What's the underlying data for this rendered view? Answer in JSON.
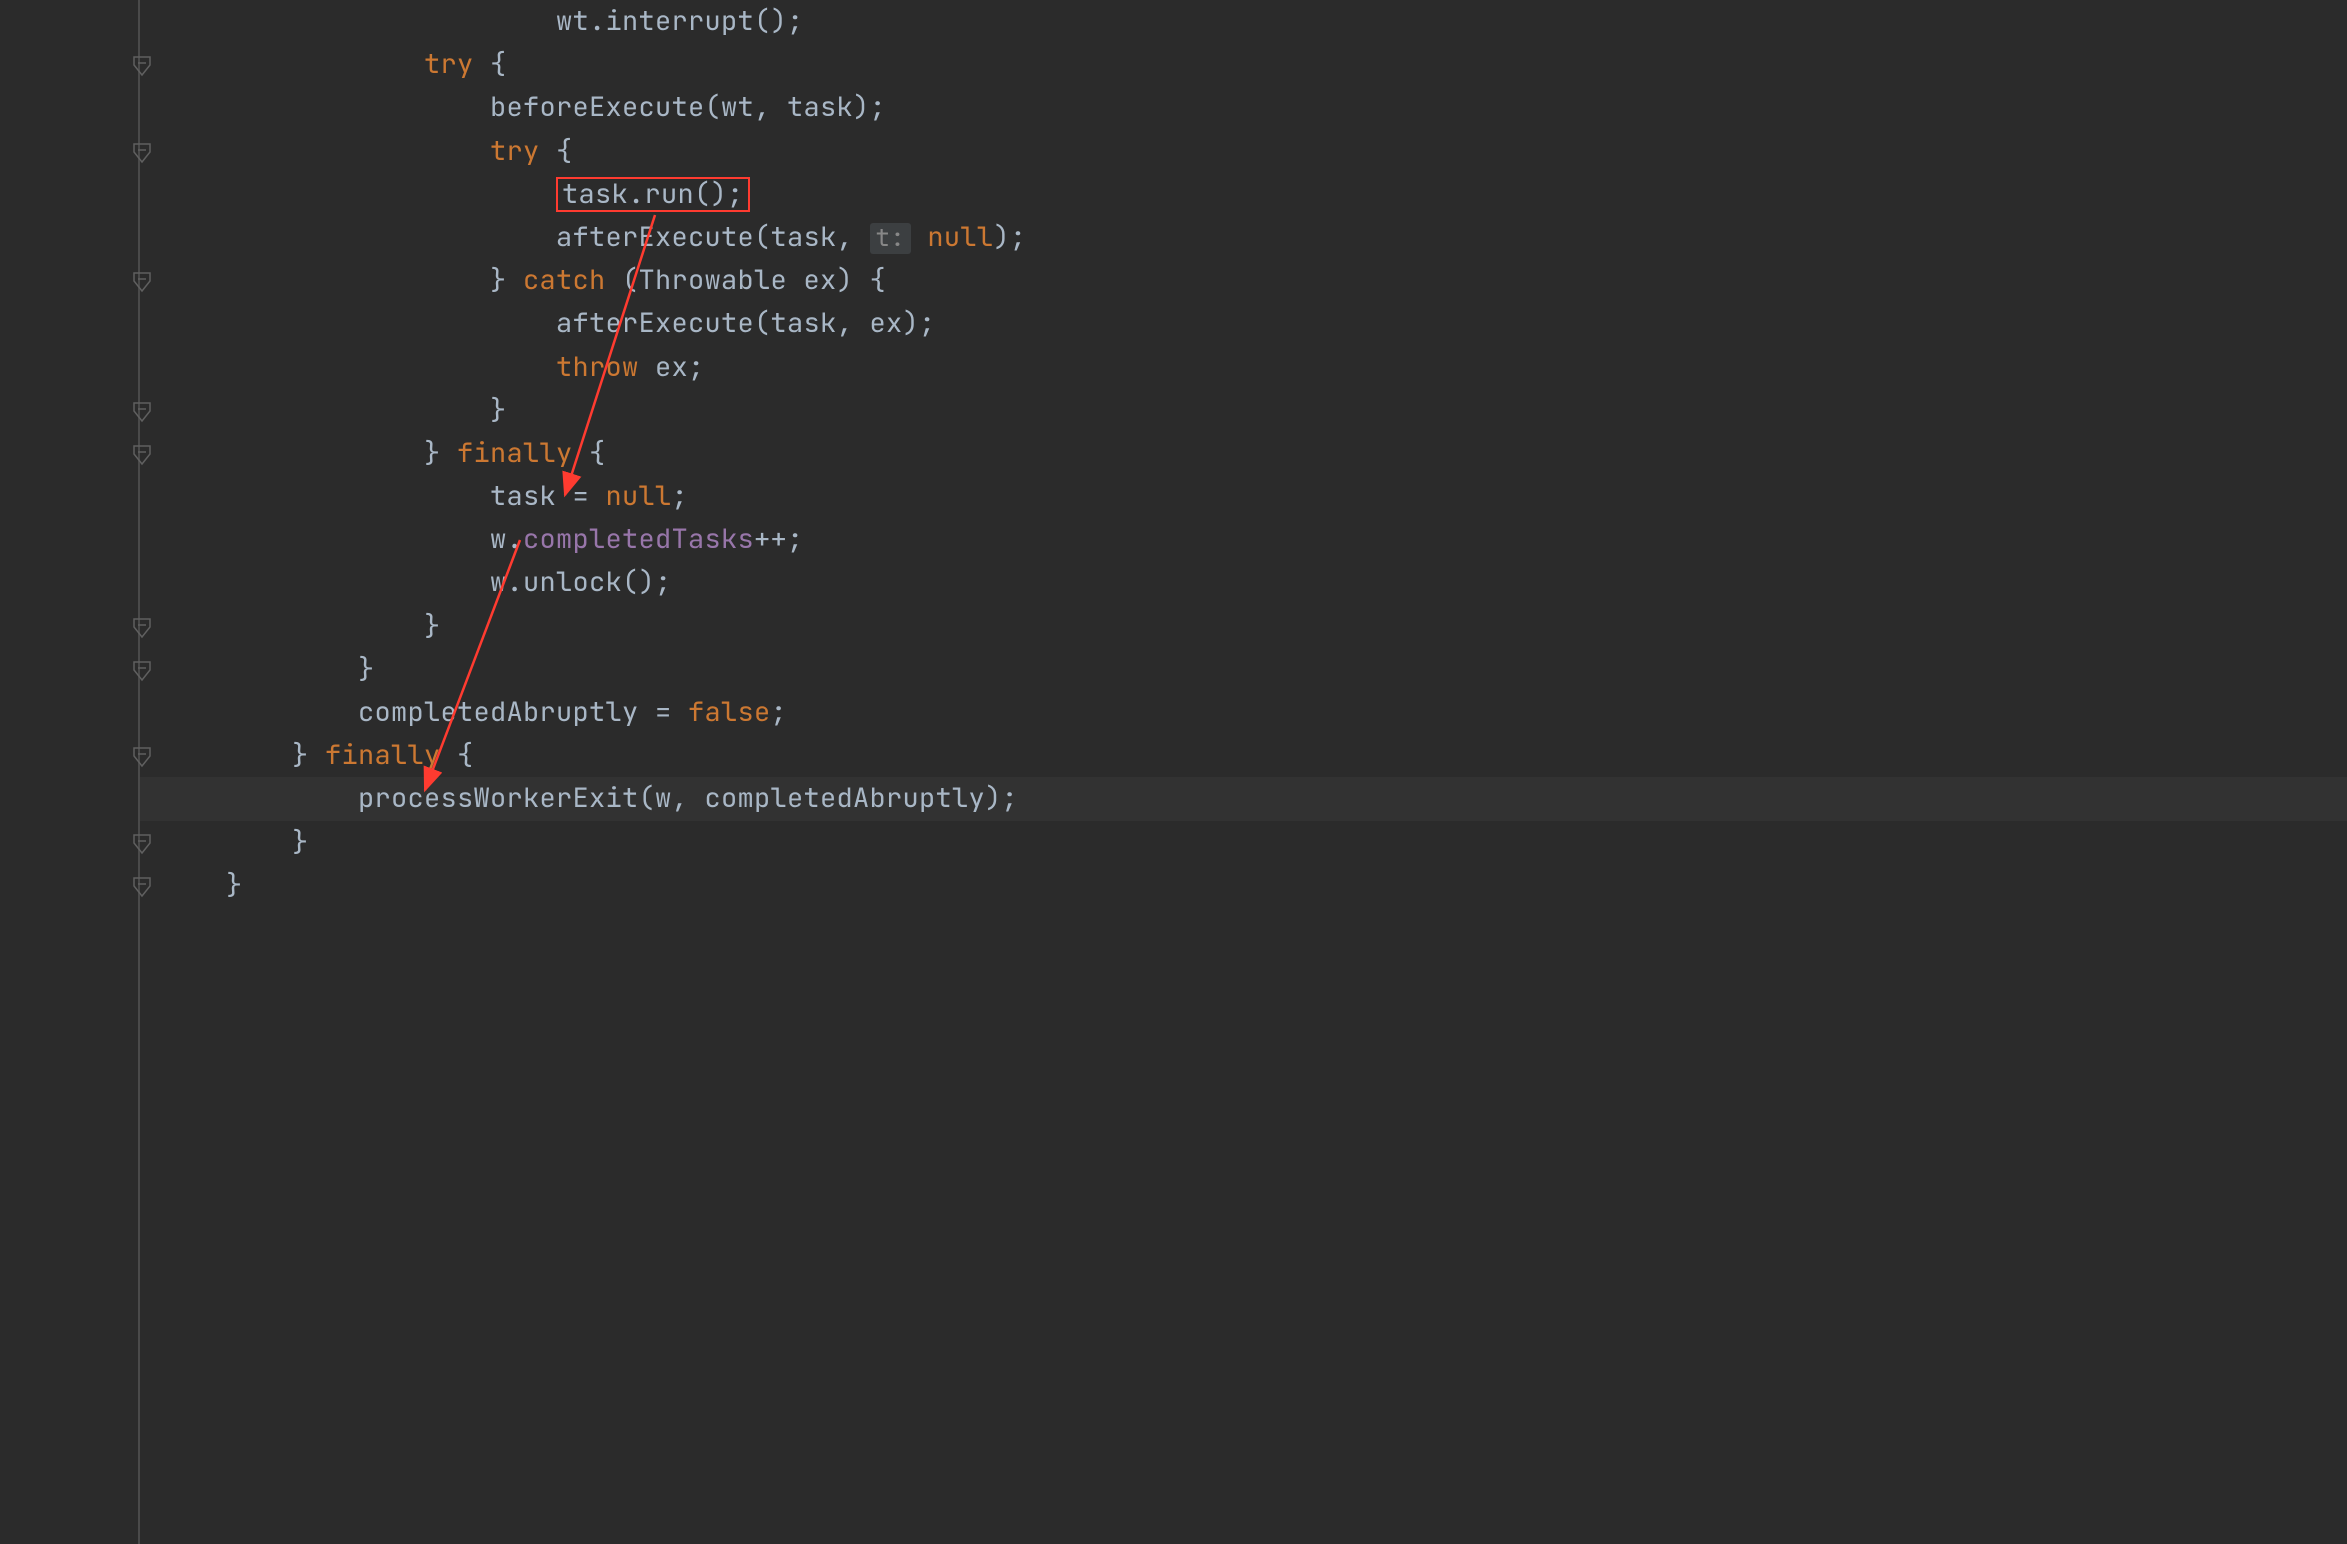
{
  "colors": {
    "background": "#2b2b2b",
    "foreground": "#a9b7c6",
    "keyword": "#cc7832",
    "member": "#9876aa",
    "highlight_box": "#ff3b30",
    "arrow": "#ff3b30",
    "current_line": "#323232",
    "gutter_line": "#4a4a4a",
    "param_hint_bg": "#3c3f41"
  },
  "code": {
    "lines": [
      {
        "indent": 24,
        "tokens": [
          {
            "t": "wt.interrupt();",
            "c": "plain"
          }
        ]
      },
      {
        "indent": 16,
        "tokens": [
          {
            "t": "try",
            "c": "kw"
          },
          {
            "t": " {",
            "c": "plain"
          }
        ],
        "fold": true
      },
      {
        "indent": 20,
        "tokens": [
          {
            "t": "beforeExecute(wt, task);",
            "c": "plain"
          }
        ]
      },
      {
        "indent": 20,
        "tokens": [
          {
            "t": "try",
            "c": "kw"
          },
          {
            "t": " {",
            "c": "plain"
          }
        ],
        "fold": true
      },
      {
        "indent": 24,
        "tokens": [
          {
            "t": "task.run();",
            "c": "plain",
            "boxed": true
          }
        ]
      },
      {
        "indent": 24,
        "tokens": [
          {
            "t": "afterExecute(task, ",
            "c": "plain"
          },
          {
            "t": "t:",
            "c": "hint"
          },
          {
            "t": " ",
            "c": "plain"
          },
          {
            "t": "null",
            "c": "kw"
          },
          {
            "t": ");",
            "c": "plain"
          }
        ]
      },
      {
        "indent": 20,
        "tokens": [
          {
            "t": "} ",
            "c": "plain"
          },
          {
            "t": "catch",
            "c": "kw"
          },
          {
            "t": " (Throwable ex) {",
            "c": "plain"
          }
        ],
        "fold": true
      },
      {
        "indent": 24,
        "tokens": [
          {
            "t": "afterExecute(task, ex);",
            "c": "plain"
          }
        ]
      },
      {
        "indent": 24,
        "tokens": [
          {
            "t": "throw",
            "c": "kw"
          },
          {
            "t": " ex;",
            "c": "plain"
          }
        ]
      },
      {
        "indent": 20,
        "tokens": [
          {
            "t": "}",
            "c": "plain"
          }
        ],
        "fold": true
      },
      {
        "indent": 16,
        "tokens": [
          {
            "t": "} ",
            "c": "plain"
          },
          {
            "t": "finally",
            "c": "kw"
          },
          {
            "t": " {",
            "c": "plain"
          }
        ],
        "fold": true
      },
      {
        "indent": 20,
        "tokens": [
          {
            "t": "task = ",
            "c": "plain"
          },
          {
            "t": "null",
            "c": "kw"
          },
          {
            "t": ";",
            "c": "plain"
          }
        ]
      },
      {
        "indent": 20,
        "tokens": [
          {
            "t": "w.",
            "c": "plain"
          },
          {
            "t": "completedTasks",
            "c": "purple"
          },
          {
            "t": "++;",
            "c": "plain"
          }
        ]
      },
      {
        "indent": 20,
        "tokens": [
          {
            "t": "w.unlock();",
            "c": "plain"
          }
        ]
      },
      {
        "indent": 16,
        "tokens": [
          {
            "t": "}",
            "c": "plain"
          }
        ],
        "fold": true
      },
      {
        "indent": 12,
        "tokens": [
          {
            "t": "}",
            "c": "plain"
          }
        ],
        "fold": true
      },
      {
        "indent": 12,
        "tokens": [
          {
            "t": "completedAbruptly = ",
            "c": "plain"
          },
          {
            "t": "false",
            "c": "kw"
          },
          {
            "t": ";",
            "c": "plain"
          }
        ]
      },
      {
        "indent": 8,
        "tokens": [
          {
            "t": "} ",
            "c": "plain"
          },
          {
            "t": "finally",
            "c": "kw"
          },
          {
            "t": " {",
            "c": "plain"
          }
        ],
        "fold": true
      },
      {
        "indent": 12,
        "tokens": [
          {
            "t": "processWorkerExit(w, completedAbruptly);",
            "c": "plain"
          }
        ],
        "highlight": true
      },
      {
        "indent": 8,
        "tokens": [
          {
            "t": "}",
            "c": "plain"
          }
        ],
        "fold": true
      },
      {
        "indent": 4,
        "tokens": [
          {
            "t": "}",
            "c": "plain"
          }
        ],
        "fold": true
      }
    ]
  },
  "annotations": {
    "boxed_line_content": "task.run();",
    "arrows": [
      {
        "from": "task.run()",
        "to": "task = null"
      },
      {
        "from": "task.run()",
        "to": "processWorkerExit"
      }
    ]
  }
}
